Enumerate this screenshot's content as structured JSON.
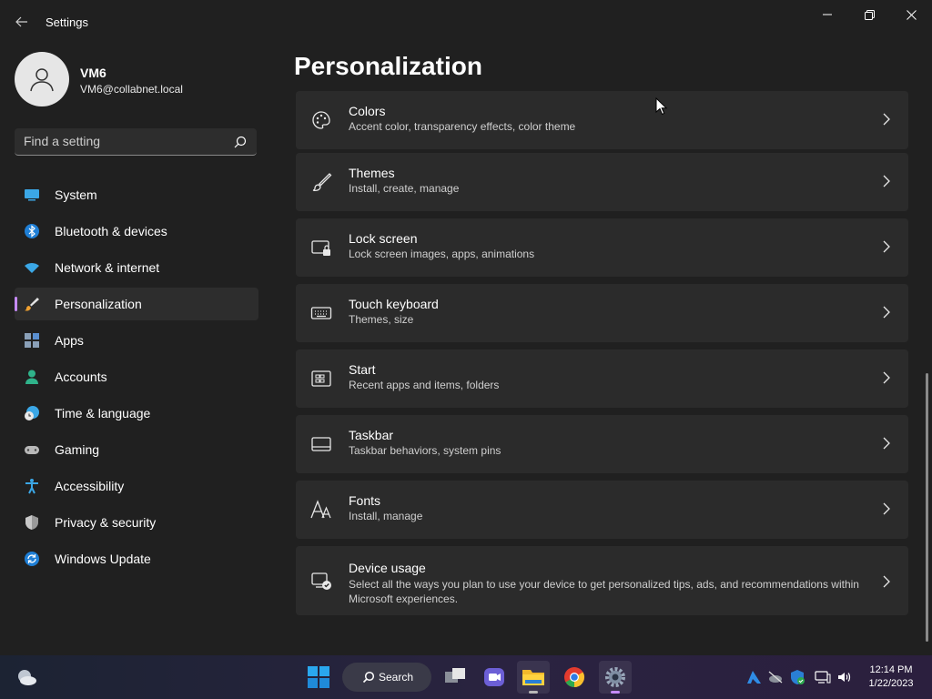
{
  "window": {
    "title": "Settings"
  },
  "profile": {
    "name": "VM6",
    "email": "VM6@collabnet.local"
  },
  "search": {
    "placeholder": "Find a setting"
  },
  "sidebar": {
    "items": [
      {
        "label": "System",
        "icon": "system-icon"
      },
      {
        "label": "Bluetooth & devices",
        "icon": "bluetooth-icon"
      },
      {
        "label": "Network & internet",
        "icon": "wifi-icon"
      },
      {
        "label": "Personalization",
        "icon": "brush-icon",
        "active": true
      },
      {
        "label": "Apps",
        "icon": "apps-icon"
      },
      {
        "label": "Accounts",
        "icon": "accounts-icon"
      },
      {
        "label": "Time & language",
        "icon": "clock-globe-icon"
      },
      {
        "label": "Gaming",
        "icon": "gamepad-icon"
      },
      {
        "label": "Accessibility",
        "icon": "accessibility-icon"
      },
      {
        "label": "Privacy & security",
        "icon": "shield-icon"
      },
      {
        "label": "Windows Update",
        "icon": "update-icon"
      }
    ]
  },
  "main": {
    "title": "Personalization",
    "cards": [
      {
        "title": "Colors",
        "subtitle": "Accent color, transparency effects, color theme",
        "icon": "palette-icon"
      },
      {
        "title": "Themes",
        "subtitle": "Install, create, manage",
        "icon": "brush-icon"
      },
      {
        "title": "Lock screen",
        "subtitle": "Lock screen images, apps, animations",
        "icon": "lock-screen-icon"
      },
      {
        "title": "Touch keyboard",
        "subtitle": "Themes, size",
        "icon": "keyboard-icon"
      },
      {
        "title": "Start",
        "subtitle": "Recent apps and items, folders",
        "icon": "start-icon"
      },
      {
        "title": "Taskbar",
        "subtitle": "Taskbar behaviors, system pins",
        "icon": "taskbar-icon"
      },
      {
        "title": "Fonts",
        "subtitle": "Install, manage",
        "icon": "fonts-icon"
      },
      {
        "title": "Device usage",
        "subtitle": "Select all the ways you plan to use your device to get personalized tips, ads, and recommendations within Microsoft experiences.",
        "icon": "device-usage-icon"
      }
    ]
  },
  "taskbar": {
    "search_label": "Search",
    "clock_time": "12:14 PM",
    "clock_date": "1/22/2023"
  },
  "colors": {
    "accent": "#c58af9",
    "background": "#202020",
    "card": "#2b2b2b"
  }
}
